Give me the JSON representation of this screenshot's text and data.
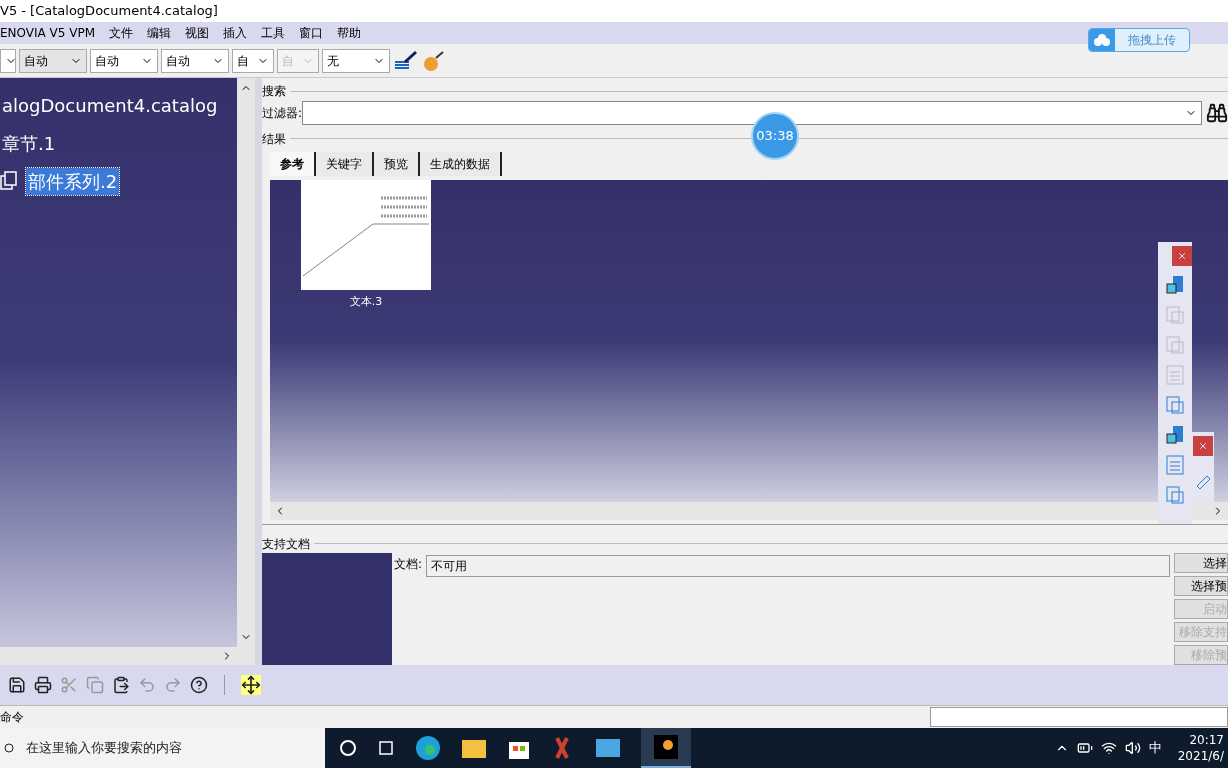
{
  "window": {
    "title": "V5 - [CatalogDocument4.catalog]"
  },
  "menu": [
    "ENOVIA V5 VPM",
    "文件",
    "编辑",
    "视图",
    "插入",
    "工具",
    "窗口",
    "帮助"
  ],
  "upload_button": {
    "label": "拖拽上传"
  },
  "combos": [
    {
      "disabled": false,
      "highlighted": false
    },
    {
      "value": "自动",
      "disabled": false,
      "highlighted": true
    },
    {
      "value": "自动",
      "disabled": false,
      "highlighted": false
    },
    {
      "value": "自动",
      "disabled": false,
      "highlighted": false
    },
    {
      "value": "自",
      "disabled": false,
      "highlighted": false
    },
    {
      "value": "自",
      "disabled": true,
      "highlighted": false
    },
    {
      "value": "无",
      "disabled": false,
      "highlighted": false
    }
  ],
  "tree": [
    {
      "label": "alogDocument4.catalog",
      "selected": false,
      "children": [
        {
          "label": "章节.1",
          "selected": false,
          "children": [
            {
              "label": "部件系列.2",
              "selected": true
            }
          ]
        }
      ]
    }
  ],
  "search": {
    "section": "搜索",
    "filter_label": "过滤器:"
  },
  "results": {
    "section": "结果",
    "tabs": [
      {
        "label": "参考",
        "selected": true
      },
      {
        "label": "关键字",
        "selected": false
      },
      {
        "label": "预览",
        "selected": false
      },
      {
        "label": "生成的数据",
        "selected": false
      }
    ],
    "items": [
      {
        "label": "文本.3"
      }
    ]
  },
  "timer": "03:38",
  "support": {
    "section": "支持文档",
    "doc_label": "文档:",
    "doc_value": "不可用",
    "buttons": [
      {
        "label": "选择",
        "disabled": false
      },
      {
        "label": "选择预",
        "disabled": false
      },
      {
        "label": "启动",
        "disabled": true
      },
      {
        "label": "移除支持",
        "disabled": true
      },
      {
        "label": "移除预",
        "disabled": true
      }
    ]
  },
  "status_bar": {
    "label": "命令"
  },
  "taskbar": {
    "search_placeholder": "在这里输入你要搜索的内容",
    "ime": "中",
    "time": "20:17",
    "date": "2021/6/"
  }
}
